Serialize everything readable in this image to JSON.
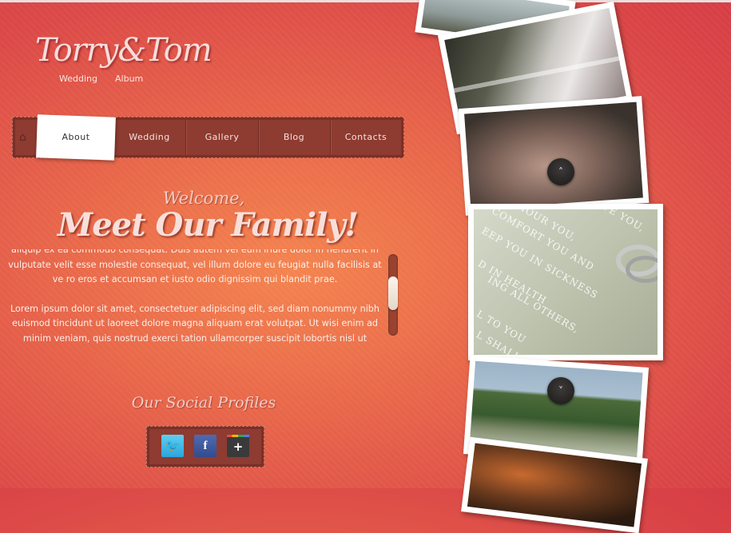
{
  "logo": {
    "main": "Torry&Tom",
    "word1": "Wedding",
    "word2": "Album"
  },
  "nav": {
    "home_icon": "home-icon",
    "items": [
      "About",
      "Wedding",
      "Gallery",
      "Blog",
      "Contacts"
    ],
    "active": "About"
  },
  "welcome": {
    "small": "Welcome,",
    "big": "Meet Our Family!",
    "paragraphs": [
      "aliquip ex ea commodo consequat. Duis autem vel eum iriure dolor in hendrerit in vulputate velit esse molestie consequat, vel illum dolore eu feugiat nulla facilisis at ve ro eros et accumsan et iusto odio dignissim qui blandit prae.",
      "Lorem ipsum dolor sit amet, consectetuer adipiscing elit, sed diam nonummy nibh euismod tincidunt ut laoreet dolore magna aliquam erat volutpat. Ut wisi enim ad minim veniam, quis nostrud exerci tation ullamcorper suscipit lobortis nisl ut"
    ]
  },
  "social": {
    "title": "Our Social Profiles",
    "icons": [
      {
        "name": "twitter-icon",
        "glyph": "🐦"
      },
      {
        "name": "facebook-icon",
        "glyph": "f"
      },
      {
        "name": "google-plus-icon",
        "glyph": "+"
      }
    ]
  },
  "gallery": {
    "photo4_lines": [
      "ONOUR YOU,",
      "COMFORT YOU AND",
      "LOVE YOU,",
      "EEP YOU IN SICKNESS",
      "D IN HEALTH",
      "ING ALL OTHERS,",
      "L TO YOU",
      "L SHALL"
    ],
    "up_glyph": "˄",
    "down_glyph": "˅"
  },
  "colors": {
    "accent": "#8e3b31",
    "background": "#e8674a"
  }
}
